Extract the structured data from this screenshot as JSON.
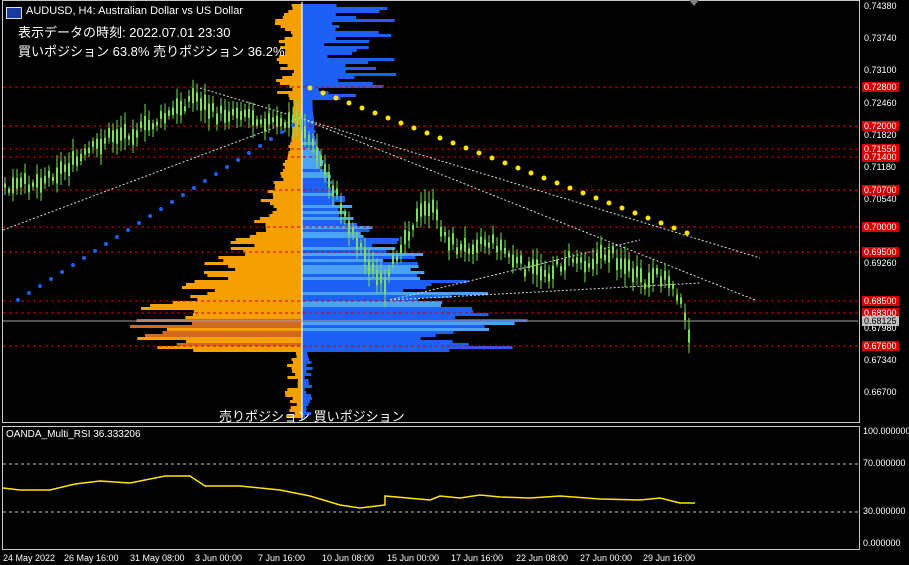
{
  "window": {
    "symbol_title": "AUDUSD, H4:  Australian Dollar vs US Dollar",
    "indicator_title": "OANDA_Multi_RSI 36.333206"
  },
  "overlay": {
    "time_label": "表示データの時刻: 2022.07.01 23:30",
    "position_label": "買いポジション 63.8% 売りポジション 36.2%",
    "bottom_label": "売りポジション 買いポジション"
  },
  "price_axis": {
    "ticks": [
      "0.74380",
      "0.73740",
      "0.73100",
      "0.72460",
      "0.71820",
      "0.71180",
      "0.70540",
      "0.69260",
      "0.67980",
      "0.67340",
      "0.66700"
    ],
    "red_levels": [
      "0.72800",
      "0.72000",
      "0.71550",
      "0.71400",
      "0.70700",
      "0.70000",
      "0.69500",
      "0.68500",
      "0.68300",
      "0.67600"
    ],
    "current_price": "0.68125"
  },
  "rsi_axis": {
    "ticks": [
      "100.000000",
      "70.000000",
      "30.000000",
      "0.000000"
    ]
  },
  "time_axis": {
    "ticks": [
      "24 May 2022",
      "26 May 16:00",
      "31 May 08:00",
      "3 Jun 00:00",
      "7 Jun 16:00",
      "10 Jun 08:00",
      "15 Jun 00:00",
      "17 Jun 16:00",
      "22 Jun 08:00",
      "27 Jun 00:00",
      "29 Jun 16:00"
    ]
  },
  "colors": {
    "sell_profile": "#f5a000",
    "sell_profile_dark": "#d2691e",
    "buy_profile": "#1e5ff5",
    "buy_profile_light": "#4aa3f5",
    "candles": "#7ddc5a",
    "level_line": "#d40000",
    "dots": "#ffe600",
    "rsi_line": "#ffe600"
  }
}
